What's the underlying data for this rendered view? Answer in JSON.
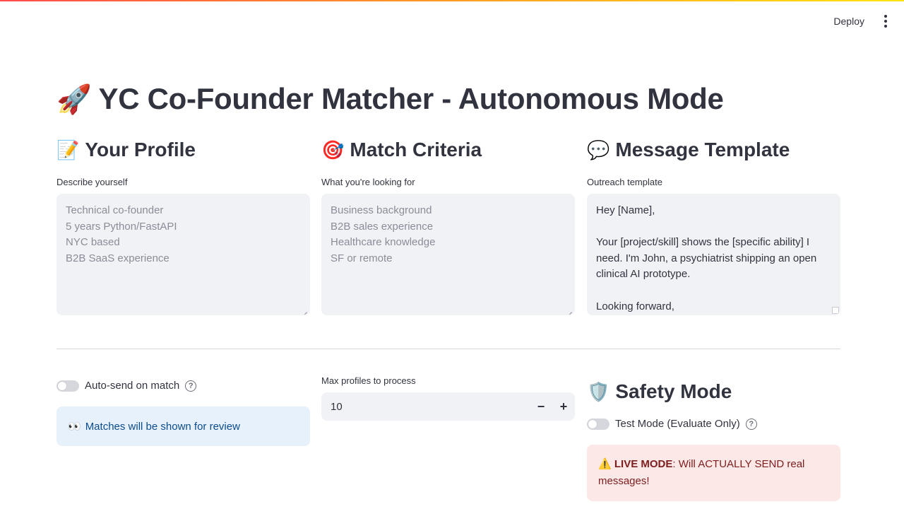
{
  "app": {
    "deploy_label": "Deploy",
    "menu_icon": "kebab-menu-icon"
  },
  "page": {
    "title_emoji": "🚀",
    "title": "YC Co-Founder Matcher - Autonomous Mode"
  },
  "profile": {
    "emoji": "📝",
    "heading": "Your Profile",
    "field_label": "Describe yourself",
    "placeholder_lines": [
      "Technical co-founder",
      "5 years Python/FastAPI",
      "NYC based",
      "B2B SaaS experience"
    ],
    "value": ""
  },
  "criteria": {
    "emoji": "🎯",
    "heading": "Match Criteria",
    "field_label": "What you're looking for",
    "placeholder_lines": [
      "Business background",
      "B2B sales experience",
      "Healthcare knowledge",
      "SF or remote"
    ],
    "value": ""
  },
  "template": {
    "emoji": "💬",
    "heading": "Message Template",
    "field_label": "Outreach template",
    "value_lines": [
      "Hey [Name],",
      "",
      "Your [project/skill] shows the [specific ability] I",
      "need. I'm John, a psychiatrist shipping an open",
      "clinical AI prototype.",
      "",
      "Looking forward,"
    ]
  },
  "auto_send": {
    "label": "Auto-send on match",
    "checked": false,
    "info_emoji": "👀",
    "info_text": "Matches will be shown for review"
  },
  "max_profiles": {
    "label": "Max profiles to process",
    "value": "10",
    "decrement_label": "−",
    "increment_label": "+"
  },
  "safety": {
    "emoji": "🛡️",
    "heading": "Safety Mode",
    "test_mode_label": "Test Mode (Evaluate Only)",
    "test_mode_checked": false,
    "warn_emoji": "⚠️",
    "warn_strong": "LIVE MODE",
    "warn_text": ": Will ACTUALLY SEND real messages!"
  },
  "colors": {
    "accent": "#ff4b4b",
    "info_bg": "#e7f1fb",
    "info_text": "#0c4c8a",
    "error_bg": "#fde8e8",
    "error_text": "#7d1d1d",
    "input_bg": "#f0f2f6"
  }
}
